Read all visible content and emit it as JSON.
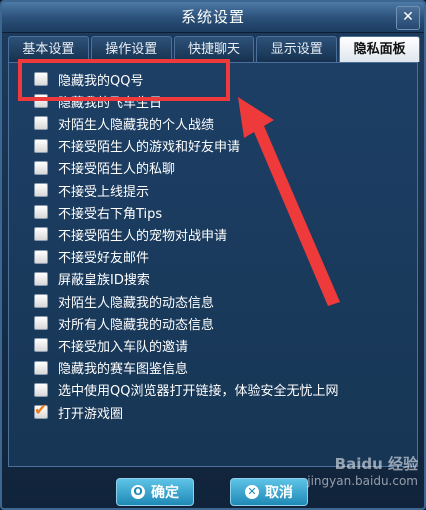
{
  "window": {
    "title": "系统设置",
    "close_glyph": "✕"
  },
  "tabs": [
    {
      "label": "基本设置",
      "active": false
    },
    {
      "label": "操作设置",
      "active": false
    },
    {
      "label": "快捷聊天",
      "active": false
    },
    {
      "label": "显示设置",
      "active": false
    },
    {
      "label": "隐私面板",
      "active": true
    }
  ],
  "options": [
    {
      "label": "隐藏我的QQ号",
      "checked": false
    },
    {
      "label": "隐藏我的飞车生日",
      "checked": false
    },
    {
      "label": "对陌生人隐藏我的个人战绩",
      "checked": false
    },
    {
      "label": "不接受陌生人的游戏和好友申请",
      "checked": false
    },
    {
      "label": "不接受陌生人的私聊",
      "checked": false
    },
    {
      "label": "不接受上线提示",
      "checked": false
    },
    {
      "label": "不接受右下角Tips",
      "checked": false
    },
    {
      "label": "不接受陌生人的宠物对战申请",
      "checked": false
    },
    {
      "label": "不接受好友邮件",
      "checked": false
    },
    {
      "label": "屏蔽皇族ID搜索",
      "checked": false
    },
    {
      "label": "对陌生人隐藏我的动态信息",
      "checked": false
    },
    {
      "label": "对所有人隐藏我的动态信息",
      "checked": false
    },
    {
      "label": "不接受加入车队的邀请",
      "checked": false
    },
    {
      "label": "隐藏我的赛车图鉴信息",
      "checked": false
    },
    {
      "label": "选中使用QQ浏览器打开链接，体验安全无忧上网",
      "checked": false
    },
    {
      "label": "打开游戏圈",
      "checked": true
    }
  ],
  "footer": {
    "ok_label": "确定",
    "cancel_label": "取消",
    "ok_icon": "O",
    "cancel_icon": "✕"
  },
  "watermark": {
    "line1": "Baidu 经验",
    "line2": "jingyan.baidu.com"
  },
  "colors": {
    "highlight": "#ee3a3a",
    "check": "#f07a18",
    "button": "#1f89b6"
  }
}
